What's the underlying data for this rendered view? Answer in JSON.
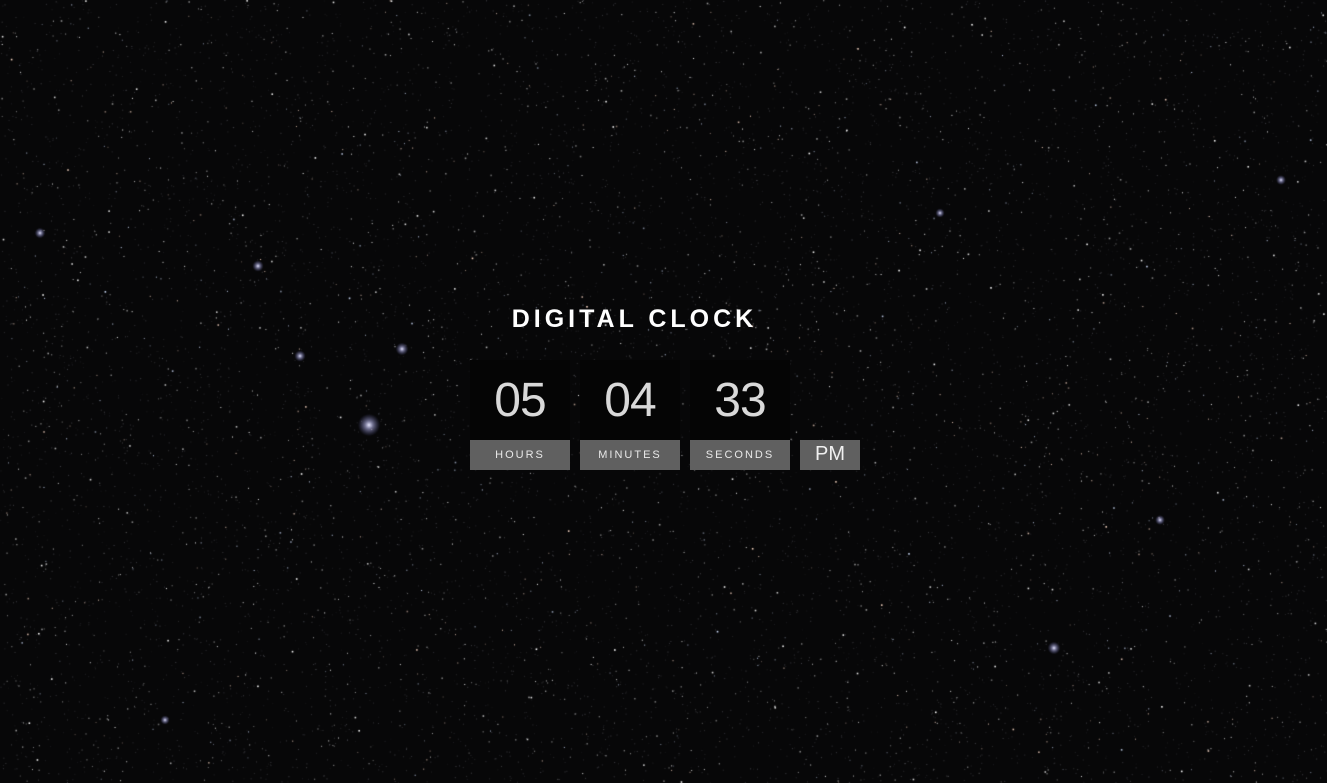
{
  "clock": {
    "title": "DIGITAL CLOCK",
    "hours": "05",
    "minutes": "04",
    "seconds": "33",
    "hours_label": "HOURS",
    "minutes_label": "MINUTES",
    "seconds_label": "SECONDS",
    "period": "PM"
  },
  "background": {
    "theme": "starry-night-sky",
    "base_color": "#070708",
    "star_color": "#ffffff",
    "digit_box_color": "#050505",
    "label_box_color": "#606060"
  }
}
